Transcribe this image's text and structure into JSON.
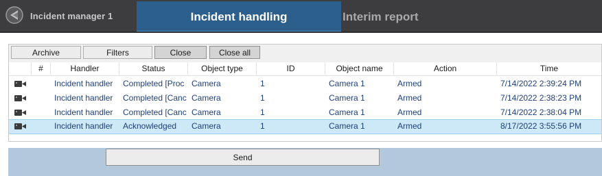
{
  "header": {
    "app_title": "Incident manager 1",
    "tabs": [
      {
        "label": "Incident handling",
        "active": true
      },
      {
        "label": "Interim report",
        "active": false
      }
    ],
    "logo_icon": "app-logo-icon"
  },
  "toolbar": {
    "buttons": [
      "Archive",
      "Filters",
      "Close",
      "Close all"
    ]
  },
  "table": {
    "columns": [
      "#",
      "Handler",
      "Status",
      "Object type",
      "ID",
      "Object name",
      "Action",
      "Time"
    ],
    "rows": [
      {
        "icon": "camera-icon",
        "handler": "Incident handler",
        "status": "Completed [Proc",
        "object_type": "Camera",
        "id": "1",
        "object_name": "Camera 1",
        "action": "Armed",
        "time": "7/14/2022 2:39:24 PM",
        "selected": false
      },
      {
        "icon": "camera-icon",
        "handler": "Incident handler",
        "status": "Completed [Canc",
        "object_type": "Camera",
        "id": "1",
        "object_name": "Camera 1",
        "action": "Armed",
        "time": "7/14/2022 2:38:23 PM",
        "selected": false
      },
      {
        "icon": "camera-icon",
        "handler": "Incident handler",
        "status": "Completed [Canc",
        "object_type": "Camera",
        "id": "1",
        "object_name": "Camera 1",
        "action": "Armed",
        "time": "7/14/2022 2:38:04 PM",
        "selected": false
      },
      {
        "icon": "camera-icon",
        "handler": "Incident handler",
        "status": "Acknowledged",
        "object_type": "Camera",
        "id": "1",
        "object_name": "Camera 1",
        "action": "Armed",
        "time": "8/17/2022 3:55:56 PM",
        "selected": true
      }
    ]
  },
  "footer": {
    "send_label": "Send"
  },
  "colors": {
    "topbar": "#3d3d3f",
    "active_tab": "#2d5f8d",
    "link_text": "#1f3f7a",
    "action_text": "#1f3f7a",
    "selected_row": "#cde8f7",
    "bottom_band": "#b3c7dd"
  }
}
